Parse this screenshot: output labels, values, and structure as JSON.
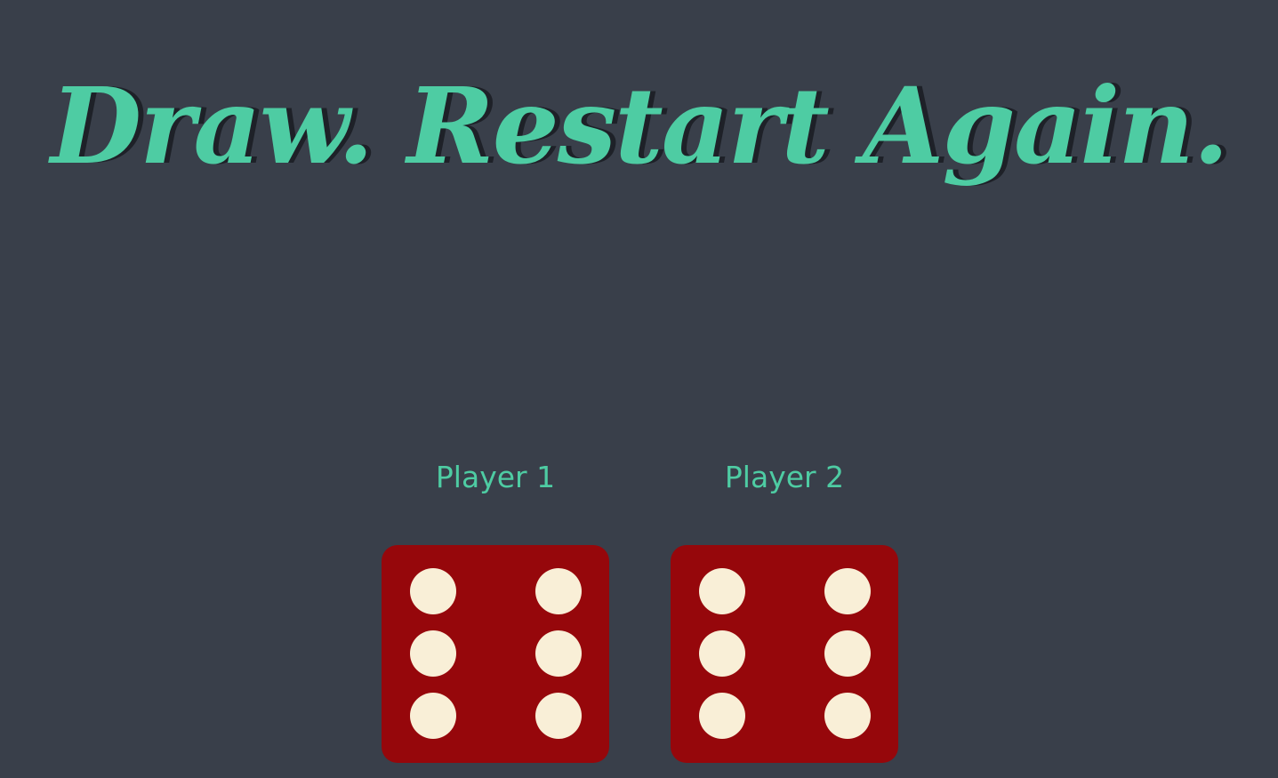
{
  "title": {
    "text": "Draw. Restart Again."
  },
  "players": [
    {
      "label": "Player 1",
      "die_value": 6
    },
    {
      "label": "Player 2",
      "die_value": 6
    }
  ],
  "colors": {
    "background": "#393f4a",
    "accent": "#4ecca3",
    "die_face": "#96070b",
    "pip": "#f9efd7"
  }
}
